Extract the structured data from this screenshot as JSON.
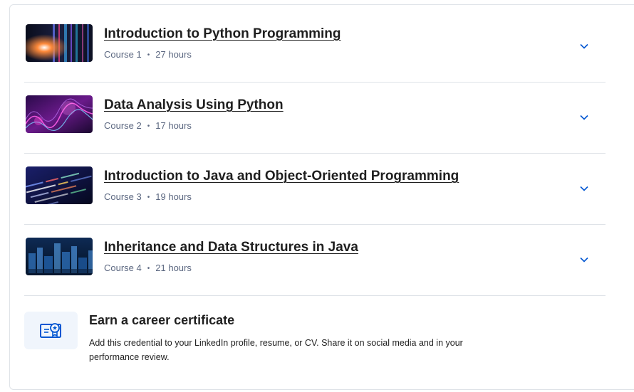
{
  "courses": [
    {
      "title": "Introduction to Python Programming",
      "course_label": "Course 1",
      "duration": "27 hours",
      "thumbnail": "server-lights-image"
    },
    {
      "title": "Data Analysis Using Python",
      "course_label": "Course 2",
      "duration": "17 hours",
      "thumbnail": "data-wave-image"
    },
    {
      "title": "Introduction to Java and Object-Oriented Programming",
      "course_label": "Course 3",
      "duration": "19 hours",
      "thumbnail": "code-screen-image"
    },
    {
      "title": "Inheritance and Data Structures in Java",
      "course_label": "Course 4",
      "duration": "21 hours",
      "thumbnail": "data-blocks-image"
    }
  ],
  "meta_separator": "•",
  "certificate": {
    "title": "Earn a career certificate",
    "description": "Add this credential to your LinkedIn profile, resume, or CV. Share it on social media and in your performance review.",
    "icon": "certificate-icon"
  },
  "colors": {
    "accent": "#0056d2",
    "text": "#1f1f1f",
    "meta": "#5b6780",
    "divider": "#dfe3e8",
    "icon_bg": "#f0f5fc"
  }
}
